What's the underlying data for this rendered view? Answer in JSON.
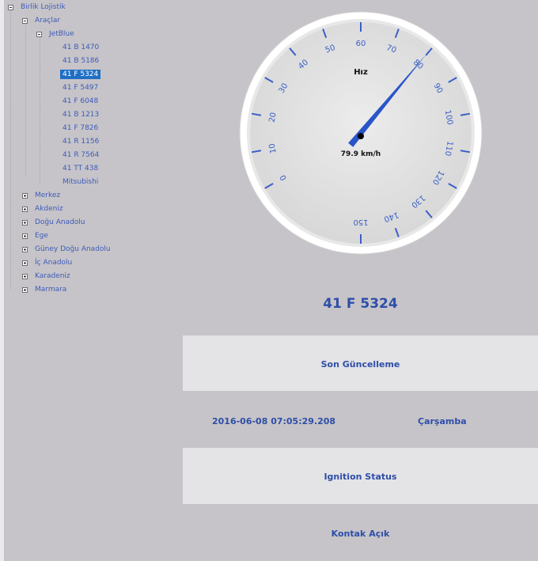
{
  "tree": {
    "root": {
      "label": "Birlik Lojistik",
      "expanded": true
    },
    "vehicles_group": {
      "label": "Araçlar",
      "expanded": true
    },
    "brand_group": {
      "label": "JetBlue",
      "expanded": true
    },
    "vehicles": [
      {
        "label": "41 B 1470",
        "selected": false
      },
      {
        "label": "41 B 5186",
        "selected": false
      },
      {
        "label": "41 F 5324",
        "selected": true
      },
      {
        "label": "41 F 5497",
        "selected": false
      },
      {
        "label": "41 F 6048",
        "selected": false
      },
      {
        "label": "41 B 1213",
        "selected": false
      },
      {
        "label": "41 F 7826",
        "selected": false
      },
      {
        "label": "41 R 1156",
        "selected": false
      },
      {
        "label": "41 R 7564",
        "selected": false
      },
      {
        "label": "41 TT 438",
        "selected": false
      },
      {
        "label": "Mitsubishi",
        "selected": false
      }
    ],
    "regions": [
      {
        "label": "Merkez",
        "expanded": false
      },
      {
        "label": "Akdeniz",
        "expanded": false
      },
      {
        "label": "Doğu Anadolu",
        "expanded": false
      },
      {
        "label": "Ege",
        "expanded": false
      },
      {
        "label": "Güney Doğu Anadolu",
        "expanded": false
      },
      {
        "label": "İç Anadolu",
        "expanded": false
      },
      {
        "label": "Karadeniz",
        "expanded": false
      },
      {
        "label": "Marmara",
        "expanded": false
      }
    ]
  },
  "gauge": {
    "title": "Hız",
    "value": 79.9,
    "readout": "79.9 km/h",
    "min": 0,
    "max": 150,
    "major_step": 10,
    "tick_labels": [
      "0",
      "10",
      "20",
      "30",
      "40",
      "50",
      "60",
      "70",
      "80",
      "90",
      "100",
      "110",
      "120",
      "130",
      "140",
      "150"
    ],
    "needle_color": "#2a55c9",
    "tick_color": "#3a5fc7"
  },
  "vehicle": {
    "plate": "41 F 5324"
  },
  "last_update": {
    "header": "Son Güncelleme",
    "timestamp": "2016-06-08 07:05:29.208",
    "day": "Çarşamba"
  },
  "ignition": {
    "header": "Ignition Status",
    "status": "Kontak Açık"
  }
}
